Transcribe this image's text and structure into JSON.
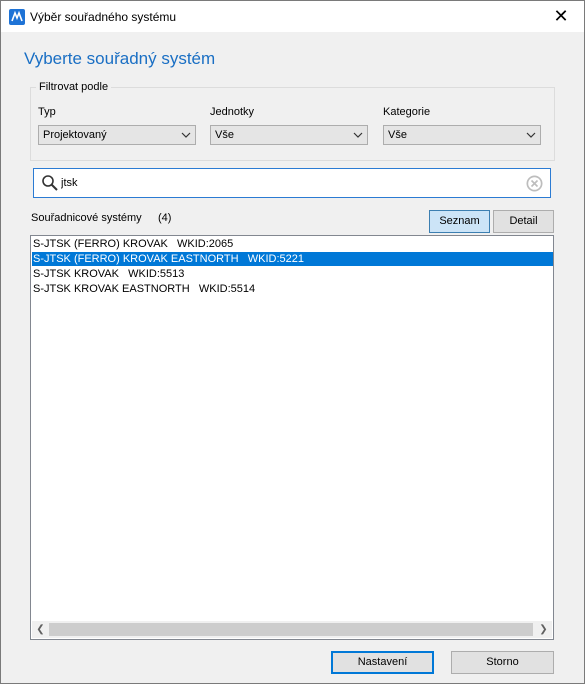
{
  "window": {
    "title": "Výběr souřadného systému",
    "close_label": "✕"
  },
  "heading": "Vyberte souřadný systém",
  "filter": {
    "caption": "Filtrovat podle",
    "type_label": "Typ",
    "type_value": "Projektovaný",
    "units_label": "Jednotky",
    "units_value": "Vše",
    "category_label": "Kategorie",
    "category_value": "Vše"
  },
  "search": {
    "value": "jtsk"
  },
  "list": {
    "label": "Souřadnicové systémy",
    "count": "(4)",
    "view_list_label": "Seznam",
    "view_detail_label": "Detail",
    "items": [
      "S-JTSK (FERRO) KROVAK   WKID:2065",
      "S-JTSK (FERRO) KROVAK EASTNORTH   WKID:5221",
      "S-JTSK KROVAK   WKID:5513",
      "S-JTSK KROVAK EASTNORTH   WKID:5514"
    ],
    "selected_index": 1
  },
  "footer": {
    "settings_label": "Nastavení",
    "cancel_label": "Storno"
  },
  "colors": {
    "accent": "#0078d7",
    "heading": "#1a6fc4"
  }
}
